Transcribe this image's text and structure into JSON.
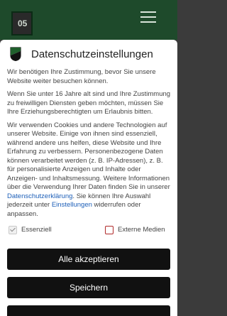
{
  "site": {
    "logo_text": "05"
  },
  "modal": {
    "title": "Datenschutzeinstellungen",
    "p1": "Wir benötigen Ihre Zustimmung, bevor Sie unsere Website weiter besuchen können.",
    "p2": "Wenn Sie unter 16 Jahre alt sind und Ihre Zustimmung zu freiwilligen Diensten geben möchten, müssen Sie Ihre Erziehungsberechtigten um Erlaubnis bitten.",
    "p3_a": "Wir verwenden Cookies und andere Technologien auf unserer Website. Einige von ihnen sind essenziell, während andere uns helfen, diese Website und Ihre Erfahrung zu verbessern. Personenbezogene Daten können verarbeitet werden (z. B. IP-Adressen), z. B. für personalisierte Anzeigen und Inhalte oder Anzeigen- und Inhaltsmessung. Weitere Informationen über die Verwendung Ihrer Daten finden Sie in unserer ",
    "p3_link1": "Datenschutzerklärung",
    "p3_b": ". Sie können Ihre Auswahl jederzeit unter ",
    "p3_link2": "Einstellungen",
    "p3_c": " widerrufen oder anpassen.",
    "consent": {
      "essential_label": "Essenziell",
      "external_label": "Externe Medien"
    },
    "buttons": {
      "accept_all": "Alle akzeptieren",
      "save": "Speichern"
    }
  }
}
